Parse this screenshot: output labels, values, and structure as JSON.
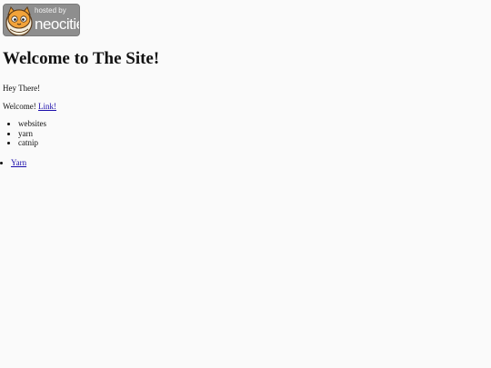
{
  "badge": {
    "small_text": "hosted by",
    "big_text": "neocities"
  },
  "page": {
    "title": "Welcome to The Site!",
    "greeting": "Hey There!",
    "welcome_text": "Welcome!",
    "welcome_link": "Link!",
    "list": [
      "websites",
      "yarn",
      "catnip"
    ],
    "link_list": [
      "Yarn"
    ]
  }
}
